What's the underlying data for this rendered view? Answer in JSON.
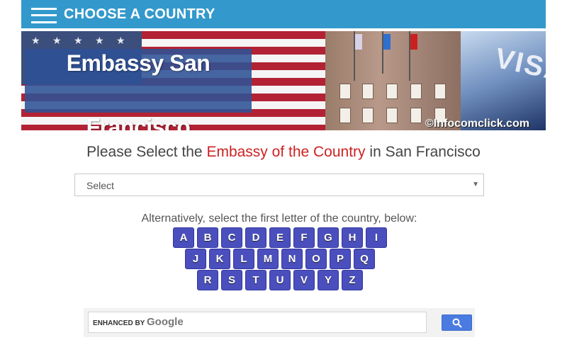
{
  "header": {
    "title": "CHOOSE A COUNTRY"
  },
  "banner": {
    "title": "Embassy San Francisco",
    "copyright": "©Infocomclick.com",
    "visa_text": "VISA"
  },
  "heading": {
    "prefix": "Please Select the ",
    "accent": "Embassy of the Country",
    "suffix": " in San Francisco"
  },
  "select": {
    "label": "Select"
  },
  "alphabet": {
    "prompt": "Alternatively, select the first letter of the country, below:",
    "rows": [
      [
        "A",
        "B",
        "C",
        "D",
        "E",
        "F",
        "G",
        "H",
        "I"
      ],
      [
        "J",
        "K",
        "L",
        "M",
        "N",
        "O",
        "P",
        "Q"
      ],
      [
        "R",
        "S",
        "T",
        "U",
        "V",
        "Y",
        "Z"
      ]
    ]
  },
  "search": {
    "enhanced_label": "ENHANCED BY",
    "brand": "Google"
  },
  "colors": {
    "bar": "#3399cc",
    "letter_button": "#4a4fbd",
    "accent": "#cc2222",
    "search_button": "#4a7be0"
  }
}
